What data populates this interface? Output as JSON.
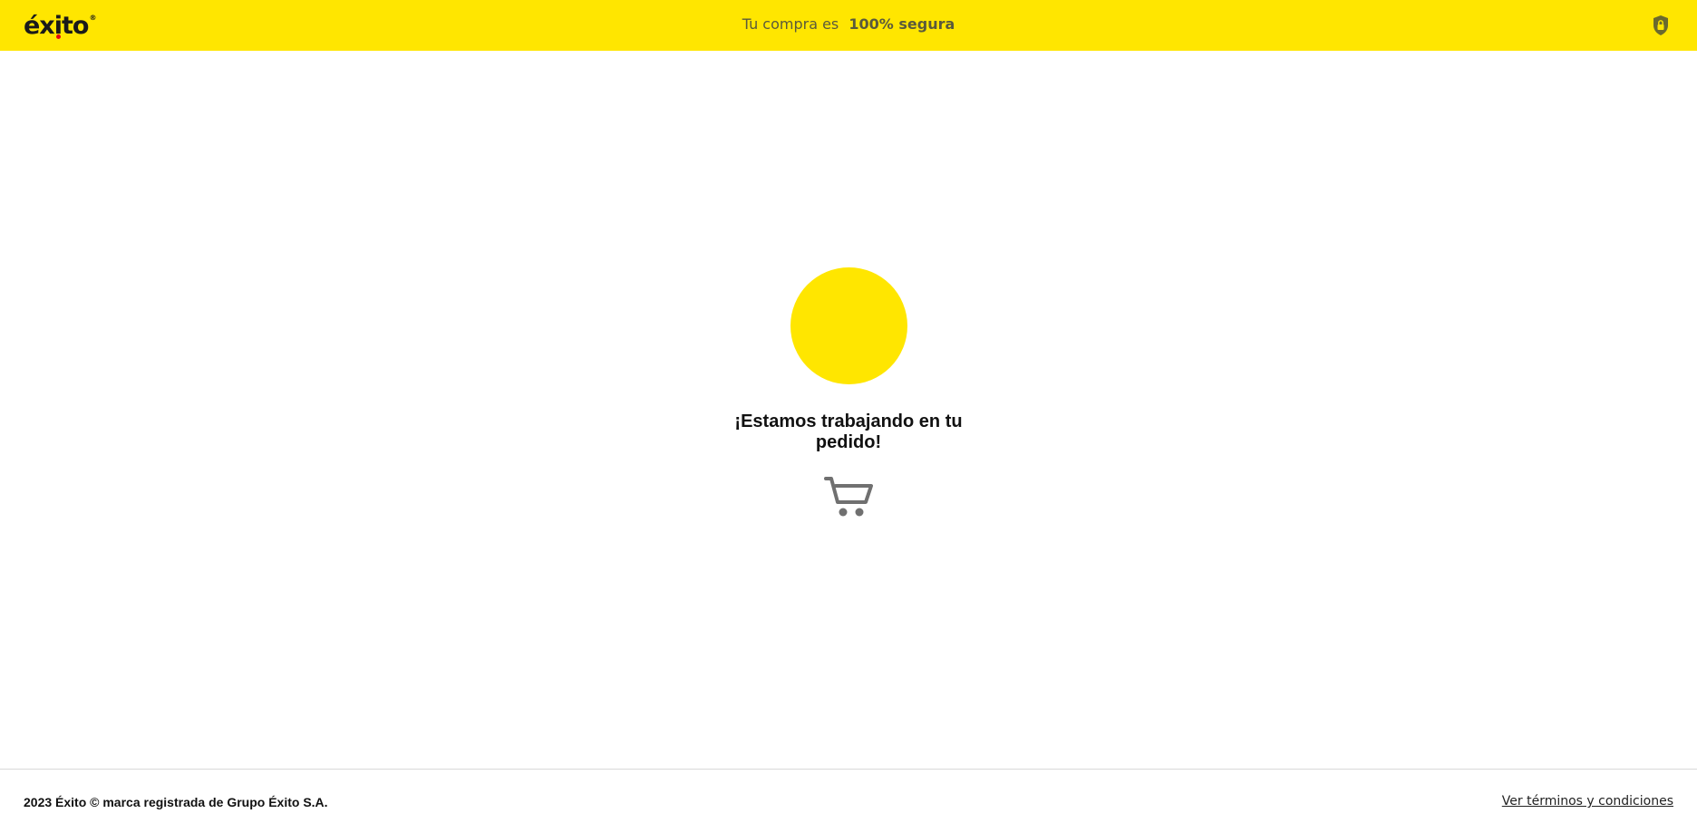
{
  "header": {
    "logo_text": "éxito",
    "logo_reg": "®",
    "secure_prefix": "Tu compra es",
    "secure_bold": "100% segura",
    "lock_icon": "lock-shield-icon"
  },
  "main": {
    "message": "¡Estamos trabajando en tu pedido!",
    "cart_icon": "shopping-cart-icon",
    "spinner_color": "#ffe600"
  },
  "footer": {
    "copyright": "2023 Éxito © marca registrada de Grupo Éxito S.A.",
    "terms_link": "Ver términos y condiciones"
  },
  "colors": {
    "brand_yellow": "#ffe600",
    "brand_red": "#e30613",
    "icon_gray": "#707070"
  }
}
